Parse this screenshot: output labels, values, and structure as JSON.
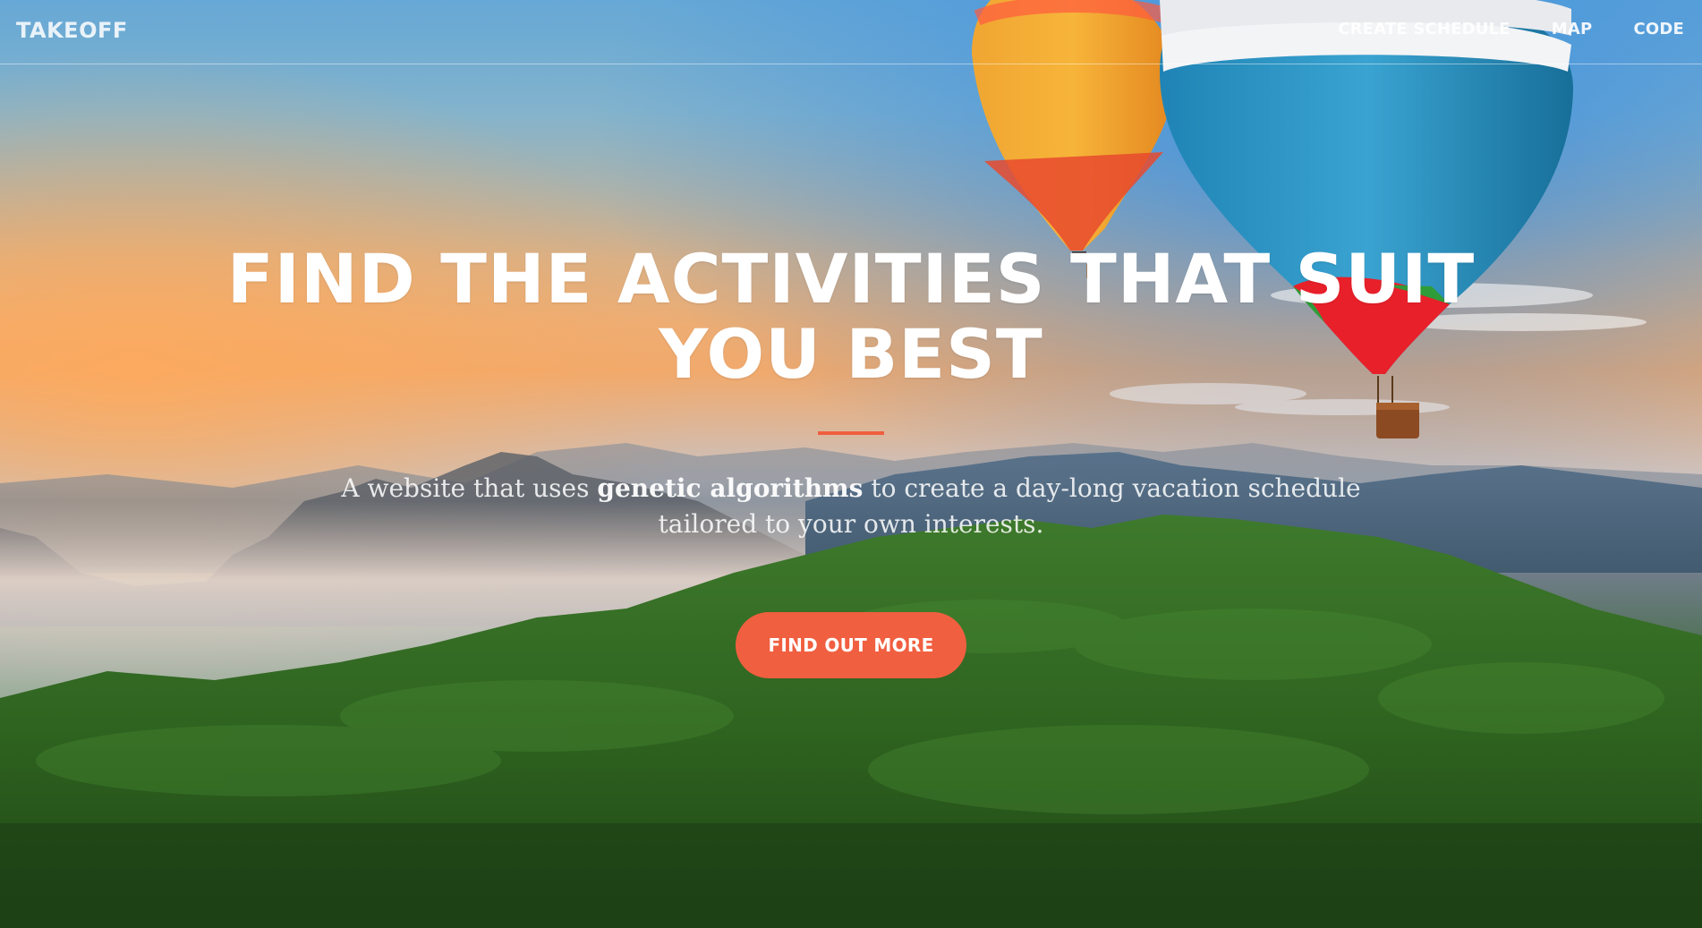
{
  "navbar": {
    "brand": "TAKEOFF",
    "links": [
      {
        "label": "CREATE SCHEDULE"
      },
      {
        "label": "MAP"
      },
      {
        "label": "CODE"
      }
    ]
  },
  "hero": {
    "heading": "FIND THE ACTIVITIES THAT SUIT YOU BEST",
    "subtitle_before": "A website that uses ",
    "subtitle_bold": "genetic algorithms",
    "subtitle_after": " to create a day-long vacation schedule tailored to your own interests.",
    "cta_label": "FIND OUT MORE"
  },
  "colors": {
    "accent": "#f05f40",
    "text": "#ffffff"
  }
}
